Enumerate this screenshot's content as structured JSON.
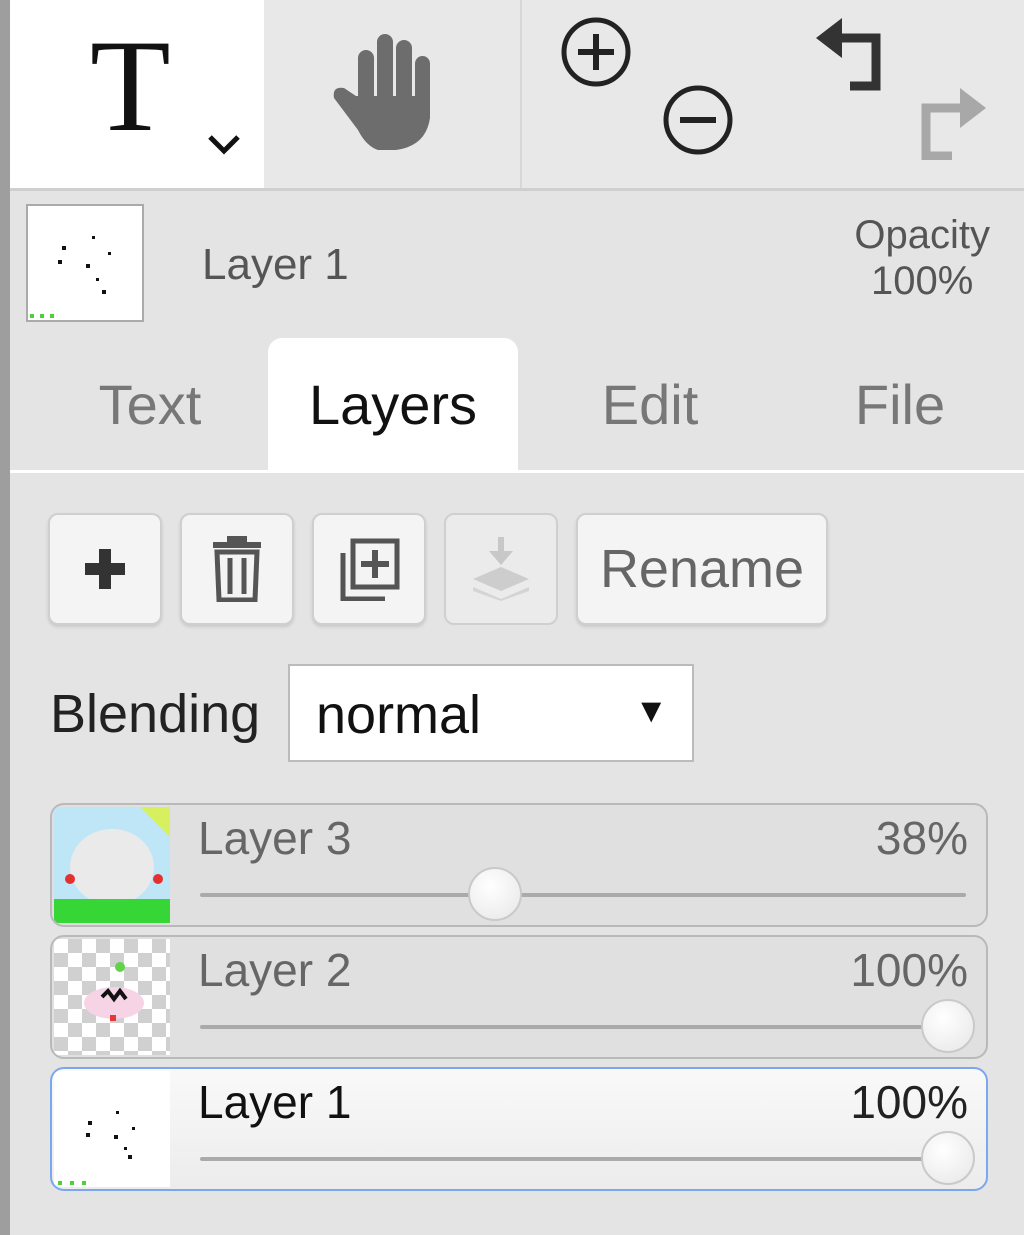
{
  "toolbar": {
    "text_tool_glyph": "T",
    "icons": [
      "text-tool-icon",
      "chevron-down-icon",
      "hand-icon",
      "zoom-in-icon",
      "zoom-out-icon",
      "undo-icon",
      "redo-icon"
    ]
  },
  "current_layer": {
    "name": "Layer 1",
    "opacity_label": "Opacity",
    "opacity_value": "100%"
  },
  "tabs": [
    {
      "label": "Text",
      "active": false
    },
    {
      "label": "Layers",
      "active": true
    },
    {
      "label": "Edit",
      "active": false
    },
    {
      "label": "File",
      "active": false
    }
  ],
  "layer_actions": {
    "add_icon": "plus-icon",
    "delete_icon": "trash-icon",
    "duplicate_icon": "duplicate-icon",
    "merge_down_icon": "merge-down-icon",
    "rename_label": "Rename"
  },
  "blending": {
    "label": "Blending",
    "selected": "normal"
  },
  "layers": [
    {
      "name": "Layer 3",
      "opacity_label": "38%",
      "opacity": 0.38,
      "selected": false
    },
    {
      "name": "Layer 2",
      "opacity_label": "100%",
      "opacity": 1.0,
      "selected": false
    },
    {
      "name": "Layer 1",
      "opacity_label": "100%",
      "opacity": 1.0,
      "selected": true
    }
  ],
  "colors": {
    "accent": "#7aa7ef",
    "background": "#e4e4e4"
  }
}
